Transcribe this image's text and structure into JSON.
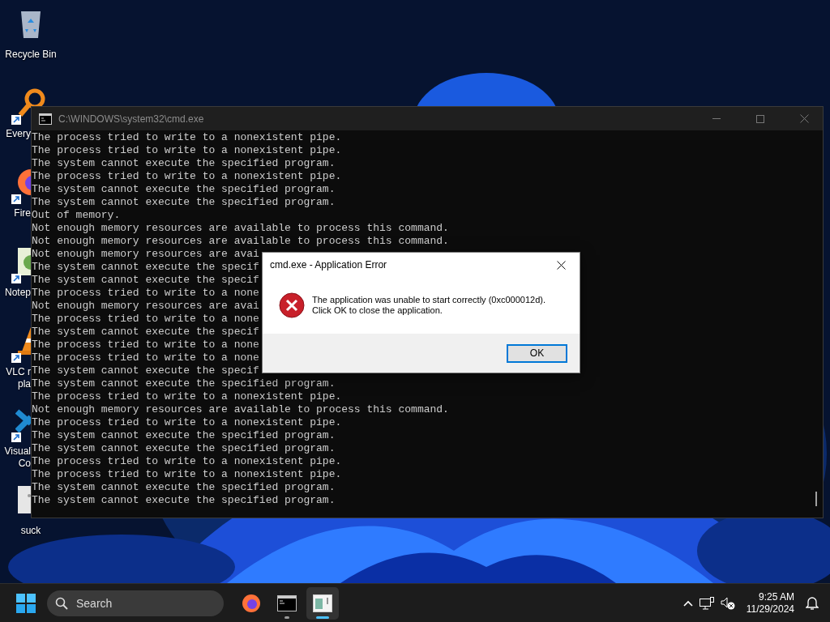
{
  "desktop_icons": [
    {
      "kind": "recycle-bin",
      "label": "Recycle Bin",
      "shortcut": false
    },
    {
      "kind": "magnifier",
      "label": "Every",
      "shortcut": true
    },
    {
      "kind": "globe",
      "label": "Fire",
      "shortcut": true
    },
    {
      "kind": "notepad",
      "label": "Notep",
      "shortcut": true
    },
    {
      "kind": "cone",
      "label": "VLC r\npla",
      "shortcut": true
    },
    {
      "kind": "ribbon",
      "label": "Visual\nCo",
      "shortcut": true
    },
    {
      "kind": "file",
      "label": "suck",
      "shortcut": false
    }
  ],
  "console_window": {
    "title": "C:\\WINDOWS\\system32\\cmd.exe",
    "active": false,
    "lines": [
      "The process tried to write to a nonexistent pipe.",
      "The process tried to write to a nonexistent pipe.",
      "The system cannot execute the specified program.",
      "The process tried to write to a nonexistent pipe.",
      "The system cannot execute the specified program.",
      "The system cannot execute the specified program.",
      "Out of memory.",
      "Not enough memory resources are available to process this command.",
      "Not enough memory resources are available to process this command.",
      "Not enough memory resources are avai",
      "The system cannot execute the specif",
      "The system cannot execute the specif",
      "The process tried to write to a none",
      "Not enough memory resources are avai",
      "The process tried to write to a none",
      "The system cannot execute the specif",
      "The process tried to write to a none",
      "The process tried to write to a none",
      "The system cannot execute the specif",
      "The system cannot execute the specified program.",
      "The process tried to write to a nonexistent pipe.",
      "Not enough memory resources are available to process this command.",
      "The process tried to write to a nonexistent pipe.",
      "The system cannot execute the specified program.",
      "The system cannot execute the specified program.",
      "The process tried to write to a nonexistent pipe.",
      "The process tried to write to a nonexistent pipe.",
      "The system cannot execute the specified program.",
      "The system cannot execute the specified program."
    ]
  },
  "dialog": {
    "title": "cmd.exe - Application Error",
    "message": "The application was unable to start correctly (0xc000012d).\nClick OK to close the application.",
    "buttons": [
      {
        "label": "OK",
        "default": true
      }
    ]
  },
  "taskbar": {
    "search": {
      "placeholder": "Search"
    },
    "apps": [
      {
        "kind": "globe",
        "running": false,
        "selected": false
      },
      {
        "kind": "terminal",
        "running": true,
        "selected": false
      },
      {
        "kind": "notepad",
        "running": true,
        "selected": true
      }
    ],
    "clock": {
      "time": "9:25 AM",
      "date": "11/29/2024"
    }
  }
}
